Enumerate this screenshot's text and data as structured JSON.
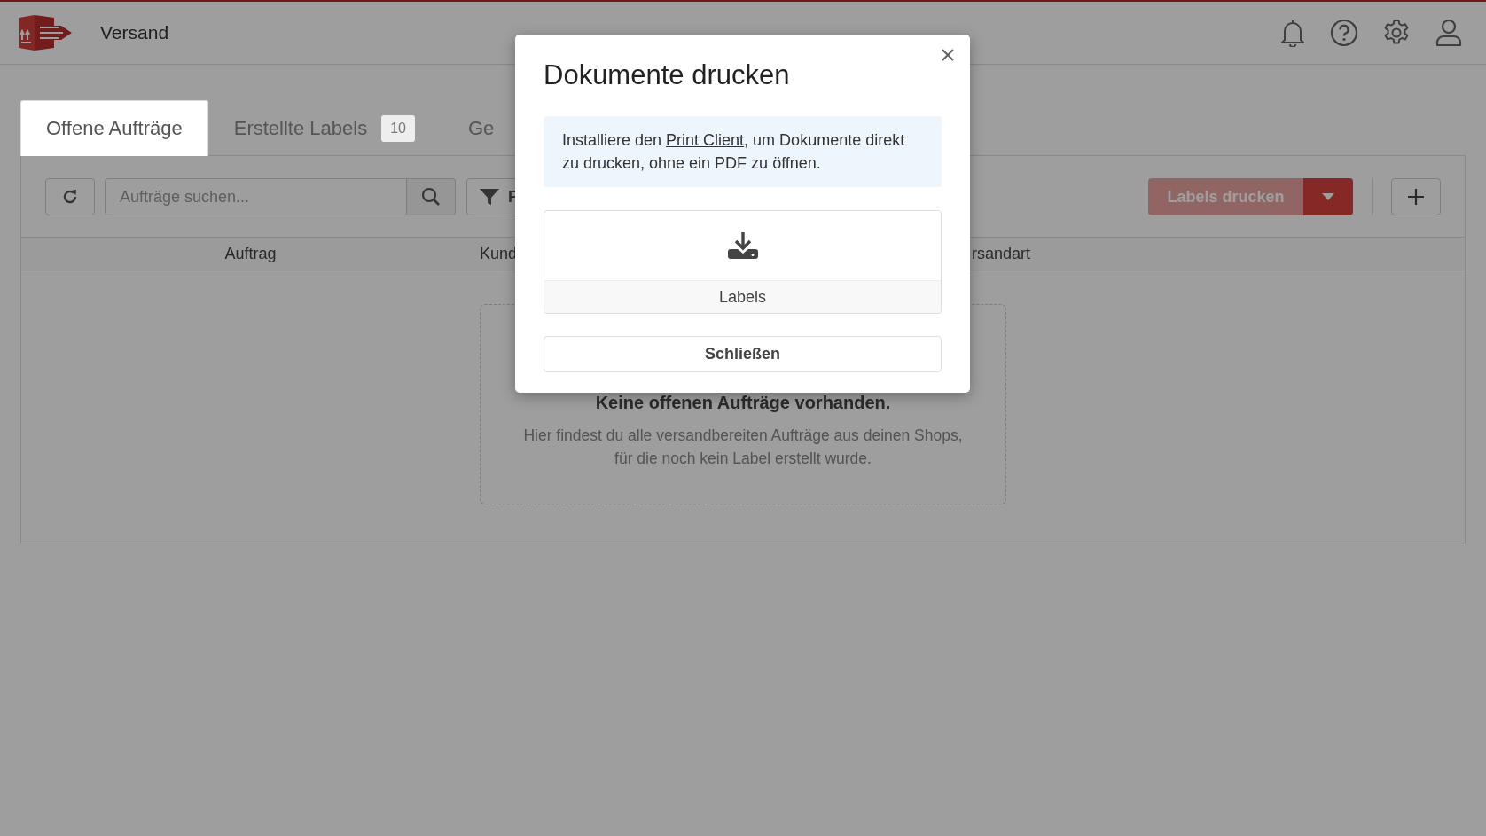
{
  "header": {
    "title": "Versand"
  },
  "tabs": [
    {
      "label": "Offene Aufträge",
      "selected": true
    },
    {
      "label": "Erstellte Labels",
      "badge": "10",
      "selected": false
    },
    {
      "label": "Ge",
      "selected": false
    }
  ],
  "toolbar": {
    "search": {
      "placeholder": "Aufträge suchen..."
    },
    "filter_label": "F",
    "print_button": "Labels drucken"
  },
  "table": {
    "columns": [
      "Auftrag",
      "Kund",
      "rsandart"
    ]
  },
  "empty_state": {
    "title": "Keine offenen Aufträge vorhanden.",
    "text": "Hier findest du alle versandbereiten Aufträge aus deinen Shops, für die noch kein Label erstellt wurde."
  },
  "dialog": {
    "title": "Dokumente drucken",
    "info": {
      "before": "Installiere den ",
      "link": "Print Client",
      "after": ", um Dokumente direkt zu drucken, ohne ein PDF zu öffnen."
    },
    "documents": [
      {
        "label": "Labels"
      }
    ],
    "close_button": "Schließen"
  }
}
